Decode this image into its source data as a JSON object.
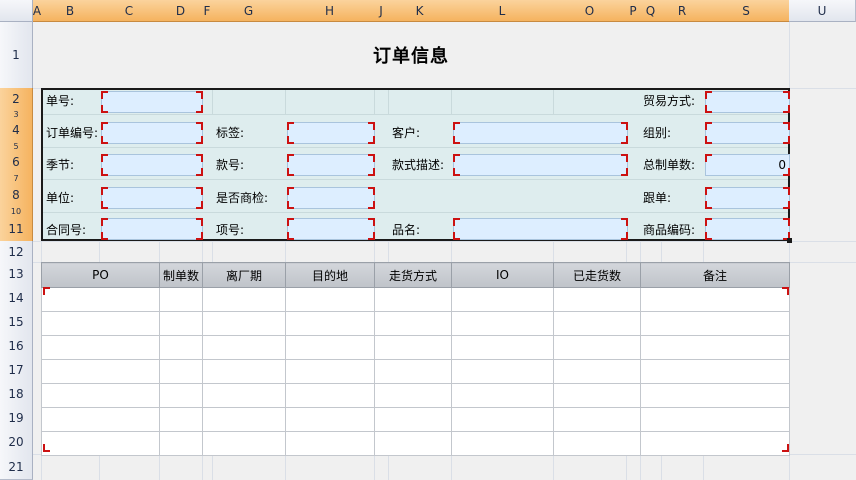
{
  "columns": [
    "A",
    "B",
    "C",
    "D",
    "F",
    "G",
    "H",
    "J",
    "K",
    "L",
    "O",
    "P",
    "Q",
    "R",
    "S",
    "U"
  ],
  "rows": [
    "1",
    "2",
    "3",
    "4",
    "5",
    "6",
    "7",
    "8",
    "10",
    "11",
    "12",
    "13",
    "14",
    "15",
    "16",
    "17",
    "18",
    "19",
    "20",
    "21"
  ],
  "title": "订单信息",
  "form": {
    "order_no_label": "单号:",
    "trade_mode_label": "贸易方式:",
    "order_code_label": "订单编号:",
    "tag_label": "标签:",
    "customer_label": "客户:",
    "group_label": "组别:",
    "season_label": "季节:",
    "style_no_label": "款号:",
    "style_desc_label": "款式描述:",
    "total_qty_label": "总制单数:",
    "total_qty_value": "0",
    "unit_label": "单位:",
    "inspection_label": "是否商检:",
    "follower_label": "跟单:",
    "contract_label": "合同号:",
    "item_no_label": "项号:",
    "product_name_label": "品名:",
    "product_code_label": "商品编码:"
  },
  "table": {
    "headers": [
      "PO",
      "制单数",
      "离厂期",
      "目的地",
      "走货方式",
      "IO",
      "已走货数",
      "备注"
    ]
  },
  "colors": {
    "header_active": "#f5b35f",
    "form_bg": "#deedee",
    "input_bg": "#ddeeff",
    "marker_red": "#cc1111"
  }
}
